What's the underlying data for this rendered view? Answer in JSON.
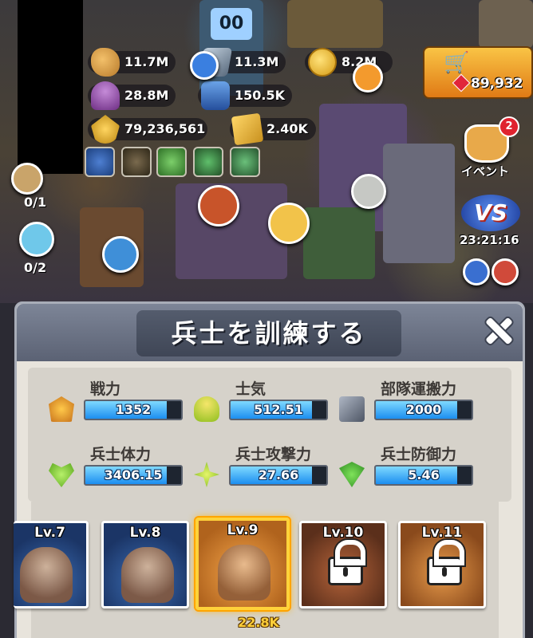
{
  "resources": [
    {
      "name": "food",
      "value": "11.7M",
      "icon": "bread-icon"
    },
    {
      "name": "steel",
      "value": "11.3M",
      "icon": "steel-icon"
    },
    {
      "name": "gold",
      "value": "8.2M",
      "icon": "coin-icon"
    },
    {
      "name": "mushroom",
      "value": "28.8M",
      "icon": "mushroom-icon"
    },
    {
      "name": "oil",
      "value": "150.5K",
      "icon": "oil-barrel-icon"
    }
  ],
  "power": {
    "value": "79,236,561",
    "icon": "medal-icon"
  },
  "cards": {
    "value": "2.40K",
    "icon": "card-icon"
  },
  "shop": {
    "gems": "89,932",
    "icon": "cart-icon"
  },
  "side": {
    "slot1": "0/1",
    "slot2": "0/2"
  },
  "event": {
    "label": "イベント",
    "badge": "2"
  },
  "vs": {
    "label": "VS",
    "timer": "23:21:16"
  },
  "clock_top": "00",
  "dialog": {
    "title": "兵士を訓練する",
    "stats": [
      {
        "label": "戦力",
        "value": "1352",
        "fill": 0.85,
        "icon": "power-icon"
      },
      {
        "label": "士気",
        "value": "512.51",
        "fill": 0.85,
        "icon": "morale-icon"
      },
      {
        "label": "部隊運搬力",
        "value": "2000",
        "fill": 0.85,
        "icon": "carry-icon"
      },
      {
        "label": "兵士体力",
        "value": "3406.15",
        "fill": 0.85,
        "icon": "health-icon"
      },
      {
        "label": "兵士攻撃力",
        "value": "27.66",
        "fill": 0.85,
        "icon": "attack-icon"
      },
      {
        "label": "兵士防御力",
        "value": "5.46",
        "fill": 0.85,
        "icon": "defense-icon"
      }
    ],
    "levels": [
      {
        "label": "Lv.7",
        "locked": false
      },
      {
        "label": "Lv.8",
        "locked": false
      },
      {
        "label": "Lv.9",
        "locked": false,
        "selected": true,
        "count": "22.8K"
      },
      {
        "label": "Lv.10",
        "locked": true
      },
      {
        "label": "Lv.11",
        "locked": true
      }
    ]
  }
}
